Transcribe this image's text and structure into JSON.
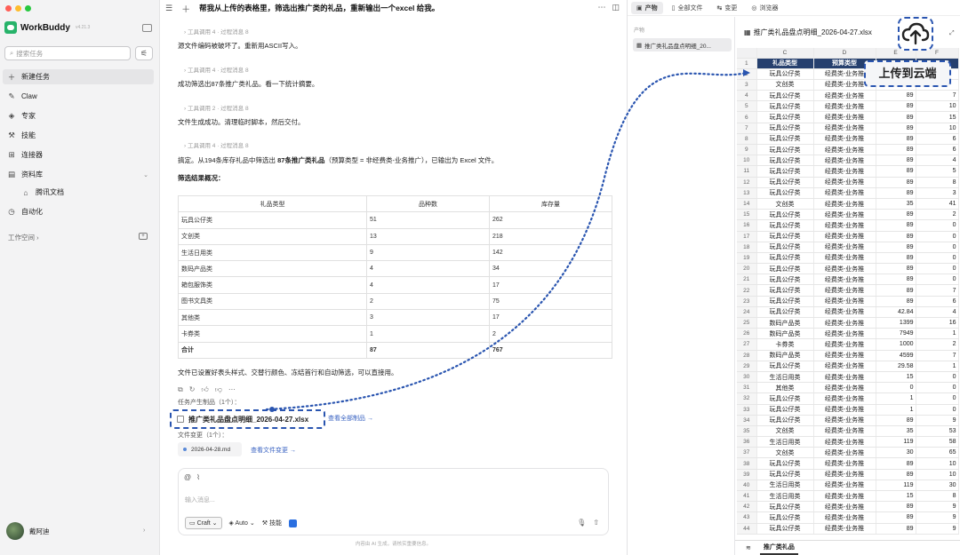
{
  "app": {
    "name": "WorkBuddy",
    "version": "v4.21.3"
  },
  "sidebar": {
    "search_placeholder": "搜索任务",
    "nav": [
      {
        "label": "新建任务",
        "icon": "plus-icon"
      },
      {
        "label": "Claw",
        "icon": "claw-icon"
      },
      {
        "label": "专家",
        "icon": "expert-icon"
      },
      {
        "label": "技能",
        "icon": "skill-icon"
      },
      {
        "label": "连接器",
        "icon": "connector-icon"
      },
      {
        "label": "资料库",
        "icon": "library-icon"
      },
      {
        "label": "腾讯文档",
        "icon": "doc-icon"
      },
      {
        "label": "自动化",
        "icon": "clock-icon"
      }
    ],
    "workspace_label": "工作空间",
    "user_name": "戴阿迪"
  },
  "chat": {
    "title": "帮我从上传的表格里，筛选出推广类的礼品，重新输出一个excel 给我。",
    "tool_lines": [
      "工具调用 4 · 过程消息 8",
      "工具调用 4 · 过程消息 8",
      "工具调用 2 · 过程消息 8",
      "工具调用 4 · 过程消息 8"
    ],
    "messages": [
      "源文件编码被破坏了。重新用ASCII写入。",
      "成功筛选出87条推广类礼品。看一下统计摘要。",
      "文件生成成功。清理临时脚本，然后交付。"
    ],
    "summary_prefix": "搞定。从194条库存礼品中筛选出 ",
    "summary_bold": "87条推广类礼品",
    "summary_suffix": "（预算类型 = 非经费类-业务推广），已输出为 Excel 文件。",
    "overview_title": "筛选结果概况：",
    "table": {
      "headers": [
        "礼品类型",
        "品种数",
        "库存量"
      ],
      "rows": [
        [
          "玩具公仔类",
          "51",
          "262"
        ],
        [
          "文创类",
          "13",
          "218"
        ],
        [
          "生活日用类",
          "9",
          "142"
        ],
        [
          "数码产品类",
          "4",
          "34"
        ],
        [
          "箱包服饰类",
          "4",
          "17"
        ],
        [
          "图书文具类",
          "2",
          "75"
        ],
        [
          "其他类",
          "3",
          "17"
        ],
        [
          "卡券类",
          "1",
          "2"
        ]
      ],
      "total": [
        "合计",
        "87",
        "767"
      ]
    },
    "footer_note": "文件已设置好表头样式、交替行颜色、冻结首行和自动筛选，可以直接用。",
    "artifacts_title": "任务产生制品（1个）：",
    "artifact_file": "推广类礼品盘点明细_2026-04-27.xlsx",
    "view_all": "查看全部制品 →",
    "changes_title": "文件变更（1个）：",
    "change_file": "2026-04-28.md",
    "view_changes": "查看文件变更 →",
    "input_placeholder": "输入消息...",
    "mode": "Craft",
    "auto": "Auto",
    "skills": "技能",
    "disclaimer": "内容由 AI 生成，请核实重要信息。"
  },
  "right_panel": {
    "tabs": [
      "产物",
      "全部文件",
      "变更",
      "浏览器"
    ],
    "list_label": "产物",
    "file_short": "推广类礼品盘点明细_20...",
    "file_title": "推广类礼品盘点明细_2026-04-27.xlsx",
    "upload_tooltip": "上传到云端",
    "sheet_tab": "推广类礼品",
    "col_letters": [
      "C",
      "D",
      "E",
      "F"
    ],
    "header_row": [
      "礼品类型",
      "预算类型",
      "",
      ""
    ],
    "rows": [
      [
        "2",
        "玩具公仔类",
        "经费类-业务推",
        "",
        ""
      ],
      [
        "3",
        "文创类",
        "经费类-业务推",
        "",
        ""
      ],
      [
        "4",
        "玩具公仔类",
        "经费类-业务推",
        "89",
        "7"
      ],
      [
        "5",
        "玩具公仔类",
        "经费类-业务推",
        "89",
        "10"
      ],
      [
        "6",
        "玩具公仔类",
        "经费类-业务推",
        "89",
        "15"
      ],
      [
        "7",
        "玩具公仔类",
        "经费类-业务推",
        "89",
        "10"
      ],
      [
        "8",
        "玩具公仔类",
        "经费类-业务推",
        "89",
        "6"
      ],
      [
        "9",
        "玩具公仔类",
        "经费类-业务推",
        "89",
        "6"
      ],
      [
        "10",
        "玩具公仔类",
        "经费类-业务推",
        "89",
        "4"
      ],
      [
        "11",
        "玩具公仔类",
        "经费类-业务推",
        "89",
        "5"
      ],
      [
        "12",
        "玩具公仔类",
        "经费类-业务推",
        "89",
        "8"
      ],
      [
        "13",
        "玩具公仔类",
        "经费类-业务推",
        "89",
        "3"
      ],
      [
        "14",
        "文创类",
        "经费类-业务推",
        "35",
        "41"
      ],
      [
        "15",
        "玩具公仔类",
        "经费类-业务推",
        "89",
        "2"
      ],
      [
        "16",
        "玩具公仔类",
        "经费类-业务推",
        "89",
        "0"
      ],
      [
        "17",
        "玩具公仔类",
        "经费类-业务推",
        "89",
        "0"
      ],
      [
        "18",
        "玩具公仔类",
        "经费类-业务推",
        "89",
        "0"
      ],
      [
        "19",
        "玩具公仔类",
        "经费类-业务推",
        "89",
        "0"
      ],
      [
        "20",
        "玩具公仔类",
        "经费类-业务推",
        "89",
        "0"
      ],
      [
        "21",
        "玩具公仔类",
        "经费类-业务推",
        "89",
        "0"
      ],
      [
        "22",
        "玩具公仔类",
        "经费类-业务推",
        "89",
        "7"
      ],
      [
        "23",
        "玩具公仔类",
        "经费类-业务推",
        "89",
        "6"
      ],
      [
        "24",
        "玩具公仔类",
        "经费类-业务推",
        "42.84",
        "4"
      ],
      [
        "25",
        "数码产品类",
        "经费类-业务推",
        "1399",
        "16"
      ],
      [
        "26",
        "数码产品类",
        "经费类-业务推",
        "7949",
        "1"
      ],
      [
        "27",
        "卡券类",
        "经费类-业务推",
        "1000",
        "2"
      ],
      [
        "28",
        "数码产品类",
        "经费类-业务推",
        "4599",
        "7"
      ],
      [
        "29",
        "玩具公仔类",
        "经费类-业务推",
        "29.58",
        "1"
      ],
      [
        "30",
        "生活日用类",
        "经费类-业务推",
        "15",
        "0"
      ],
      [
        "31",
        "其他类",
        "经费类-业务推",
        "0",
        "0"
      ],
      [
        "32",
        "玩具公仔类",
        "经费类-业务推",
        "1",
        "0"
      ],
      [
        "33",
        "玩具公仔类",
        "经费类-业务推",
        "1",
        "0"
      ],
      [
        "34",
        "玩具公仔类",
        "经费类-业务推",
        "89",
        "9"
      ],
      [
        "35",
        "文创类",
        "经费类-业务推",
        "35",
        "53"
      ],
      [
        "36",
        "生活日用类",
        "经费类-业务推",
        "119",
        "58"
      ],
      [
        "37",
        "文创类",
        "经费类-业务推",
        "30",
        "65"
      ],
      [
        "38",
        "玩具公仔类",
        "经费类-业务推",
        "89",
        "10"
      ],
      [
        "39",
        "玩具公仔类",
        "经费类-业务推",
        "89",
        "10"
      ],
      [
        "40",
        "生活日用类",
        "经费类-业务推",
        "119",
        "30"
      ],
      [
        "41",
        "生活日用类",
        "经费类-业务推",
        "15",
        "8"
      ],
      [
        "42",
        "玩具公仔类",
        "经费类-业务推",
        "89",
        "9"
      ],
      [
        "43",
        "玩具公仔类",
        "经费类-业务推",
        "89",
        "9"
      ],
      [
        "44",
        "玩具公仔类",
        "经费类-业务推",
        "89",
        "9"
      ]
    ]
  },
  "colors": {
    "accent_blue": "#2a55b0",
    "header_navy": "#26406e",
    "brand_green": "#27b36a"
  }
}
